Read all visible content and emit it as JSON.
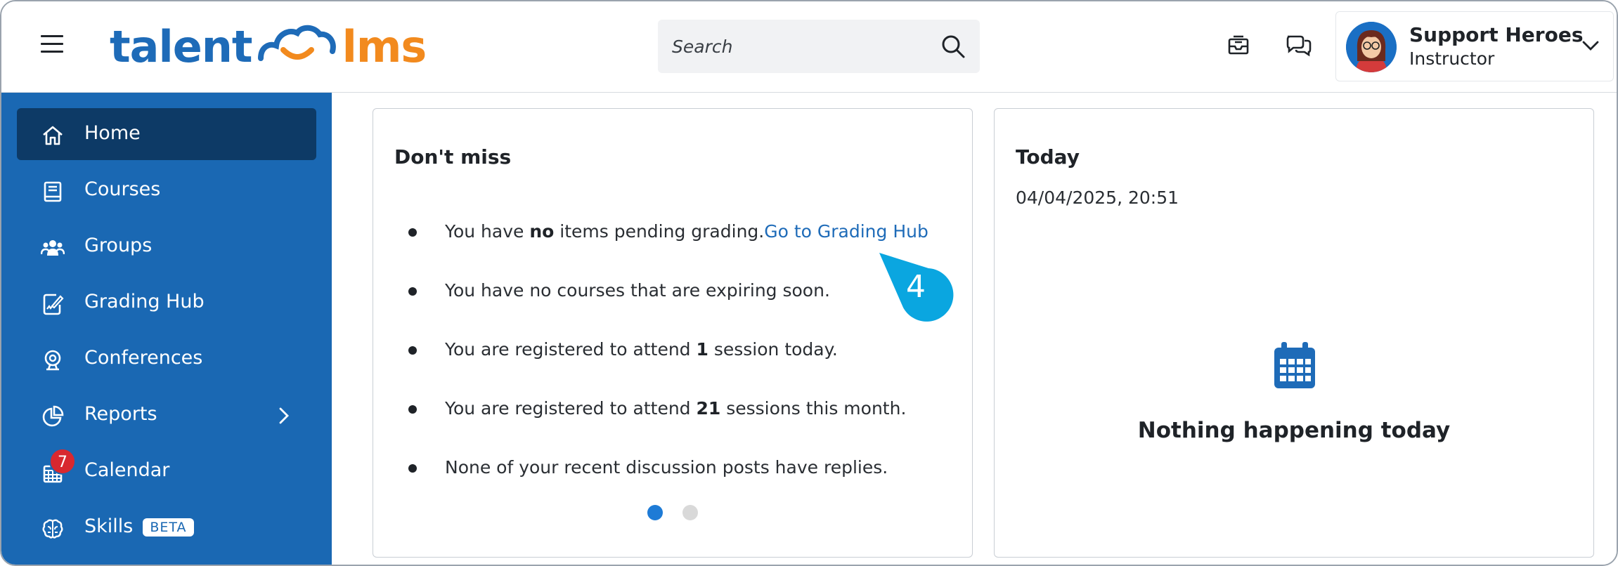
{
  "header": {
    "logo_left": "talent",
    "logo_right": "lms",
    "search_placeholder": "Search",
    "user": {
      "name": "Support Heroes",
      "role": "Instructor"
    },
    "icons": [
      "menu-icon",
      "search-icon",
      "inbox-icon",
      "chat-icon",
      "chevron-down-icon"
    ]
  },
  "sidebar": {
    "items": [
      {
        "label": "Home",
        "icon": "home-icon",
        "active": true
      },
      {
        "label": "Courses",
        "icon": "book-icon"
      },
      {
        "label": "Groups",
        "icon": "users-icon"
      },
      {
        "label": "Grading Hub",
        "icon": "grading-icon"
      },
      {
        "label": "Conferences",
        "icon": "webcam-icon"
      },
      {
        "label": "Reports",
        "icon": "pie-chart-icon",
        "has_submenu": true
      },
      {
        "label": "Calendar",
        "icon": "calendar-icon",
        "badge": "7"
      },
      {
        "label": "Skills",
        "icon": "brain-icon",
        "tag": "BETA"
      }
    ]
  },
  "dont_miss": {
    "title": "Don't miss",
    "item1": {
      "pre": "You have ",
      "bold": "no",
      "post": " items pending grading.",
      "link": "Go to Grading Hub"
    },
    "item2": {
      "text": "You have no courses that are expiring soon."
    },
    "item3": {
      "pre": "You are registered to attend ",
      "bold": "1",
      "post": " session today."
    },
    "item4": {
      "pre": "You are registered to attend ",
      "bold": "21",
      "post": " sessions this month."
    },
    "item5": {
      "text": "None of your recent discussion posts have replies."
    },
    "callout_number": "4",
    "pager": {
      "pages": 2,
      "current": 1
    }
  },
  "today": {
    "title": "Today",
    "datetime": "04/04/2025, 20:51",
    "empty_message": "Nothing happening today"
  },
  "colors": {
    "sidebar": "#1a68b3",
    "sidebar_active": "#0d3a66",
    "brand_blue": "#1e6bb8",
    "brand_orange": "#f28a1e",
    "callout": "#0aa6e0",
    "badge": "#d8282f"
  }
}
